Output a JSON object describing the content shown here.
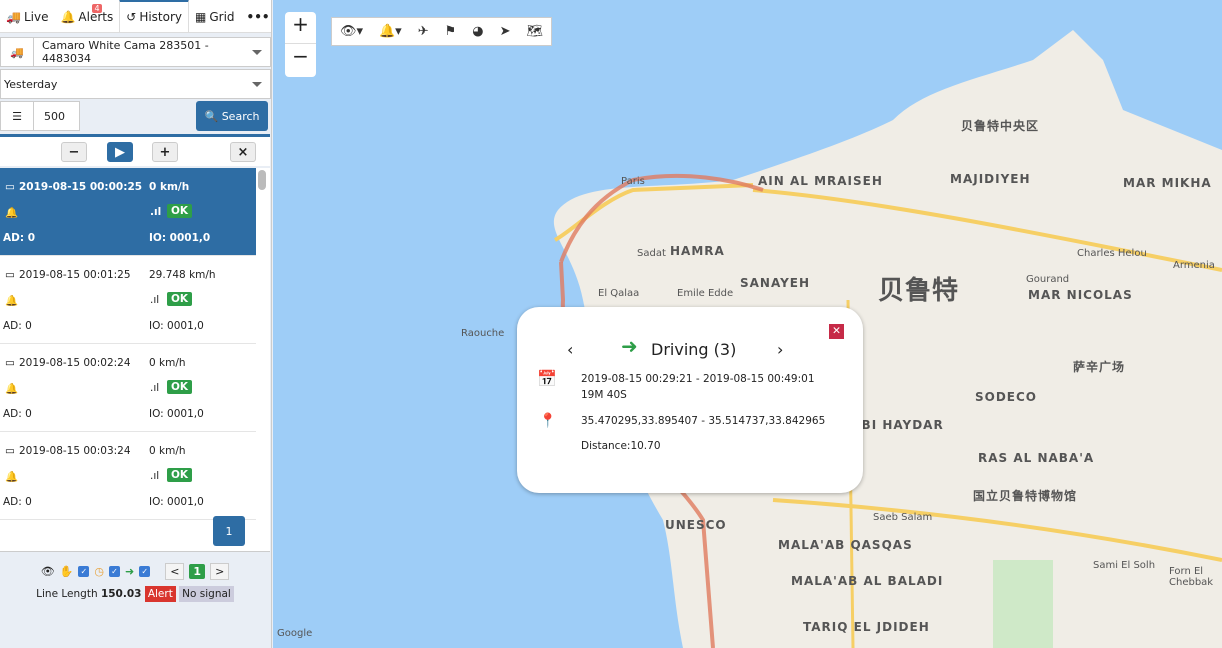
{
  "tabs": [
    {
      "label": "Live",
      "icon": "truck-icon"
    },
    {
      "label": "Alerts",
      "icon": "bell-icon",
      "badge": "4"
    },
    {
      "label": "History",
      "icon": "history-icon"
    },
    {
      "label": "Grid",
      "icon": "table-icon"
    },
    {
      "label": "•••"
    }
  ],
  "vehicle": "Camaro White Cama 283501 - 4483034",
  "period": "Yesterday",
  "limit": "500",
  "search_label": "Search",
  "items": [
    {
      "time": "2019-08-15 00:00:25",
      "speed": "0 km/h",
      "status": "OK",
      "ad": "AD: 0",
      "io": "IO: 0001,0"
    },
    {
      "time": "2019-08-15 00:01:25",
      "speed": "29.748 km/h",
      "status": "OK",
      "ad": "AD: 0",
      "io": "IO: 0001,0"
    },
    {
      "time": "2019-08-15 00:02:24",
      "speed": "0 km/h",
      "status": "OK",
      "ad": "AD: 0",
      "io": "IO: 0001,0"
    },
    {
      "time": "2019-08-15 00:03:24",
      "speed": "0 km/h",
      "status": "OK",
      "ad": "AD: 0",
      "io": "IO: 0001,0"
    }
  ],
  "page": "1",
  "footer": {
    "page": "1",
    "line_length_label": "Line Length",
    "line_length": "150.03",
    "alert": "Alert",
    "no_signal": "No signal"
  },
  "popup": {
    "title": "Driving (3)",
    "time_range": "2019-08-15 00:29:21 - 2019-08-15 00:49:01",
    "duration": "19M 40S",
    "coords": "35.470295,33.895407 - 35.514737,33.842965",
    "distance": "Distance:10.70"
  },
  "map_labels": [
    "AIN AL MRAISEH",
    "MAJIDIYEH",
    "MAR MIKHA",
    "HAMRA",
    "SANAYEH",
    "MAR NICOLAS",
    "Raouche",
    "Paris",
    "El Qalaa",
    "Emile Edde",
    "Sadat",
    "Charles Helou",
    "Armenia",
    "Gourand",
    "SODECO",
    "RAS AL NABA'A",
    "ZOURQ ABI HAYDAR",
    "UNESCO",
    "MALA'AB QASQAS",
    "MALA'AB AL BALADI",
    "TARIQ EL JDIDEH",
    "Saeb Salam",
    "Forn El Chebbak",
    "Sami El Solh",
    "Google",
    "贝鲁特",
    "贝鲁特中央区",
    "萨辛广场",
    "国立贝鲁特博物馆"
  ],
  "colors": {
    "accent": "#2e6da4",
    "ok": "#2e9e48",
    "alert": "#d9352e",
    "sea": "#9ecdf7",
    "land": "#f0ede6",
    "route": "#e07a5f"
  }
}
